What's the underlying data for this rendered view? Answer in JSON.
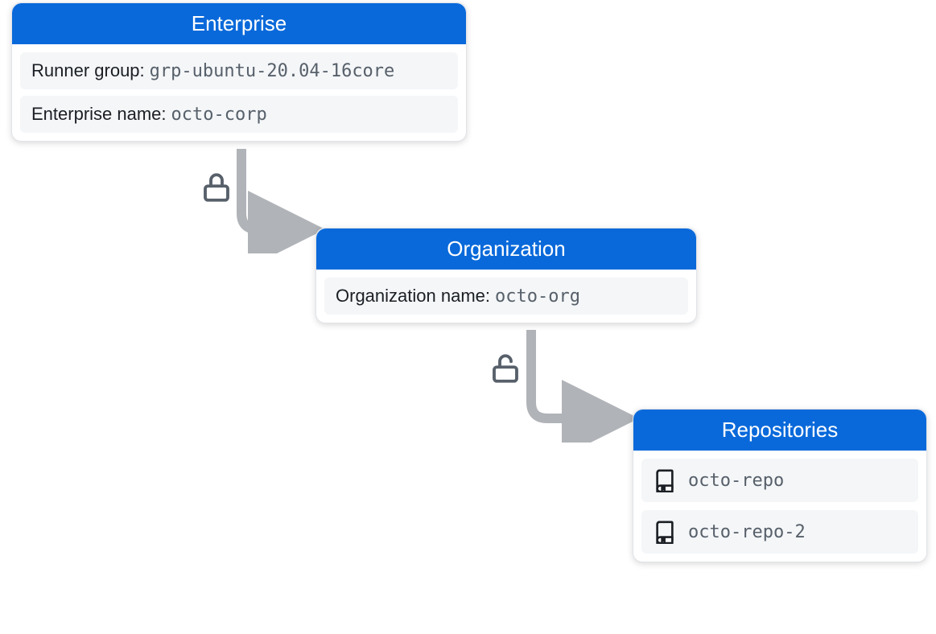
{
  "colors": {
    "header_bg": "#0969da",
    "header_text": "#ffffff",
    "field_bg": "#f4f6f8",
    "mono_text": "#57606a"
  },
  "enterprise": {
    "title": "Enterprise",
    "runner_group_label": "Runner group:",
    "runner_group_value": "grp-ubuntu-20.04-16core",
    "name_label": "Enterprise name:",
    "name_value": "octo-corp"
  },
  "organization": {
    "title": "Organization",
    "name_label": "Organization name:",
    "name_value": "octo-org"
  },
  "repositories": {
    "title": "Repositories",
    "items": [
      {
        "name": "octo-repo"
      },
      {
        "name": "octo-repo-2"
      }
    ]
  },
  "icons": {
    "connector1_state": "locked",
    "connector2_state": "unlocked"
  }
}
